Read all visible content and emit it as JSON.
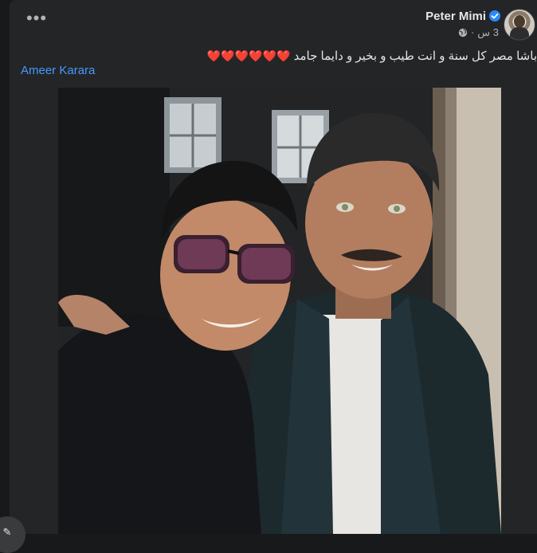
{
  "post": {
    "author": "Peter Mimi",
    "time": "3 س",
    "separator": "·",
    "text": "باشا مصر كل سنة و انت طيب و بخير و دايما جامد",
    "hearts": "❤️❤️❤️❤️❤️❤️",
    "tag": "Ameer Karara",
    "more_label": "•••"
  },
  "icons": {
    "verified": "verified-badge-icon",
    "privacy": "globe-icon",
    "more": "more-options-icon"
  },
  "colors": {
    "background": "#18191a",
    "card": "#242526",
    "text": "#e4e6eb",
    "secondary_text": "#b0b3b8",
    "link": "#4599ff",
    "verified": "#2d88ff",
    "heart": "#e0245e"
  }
}
